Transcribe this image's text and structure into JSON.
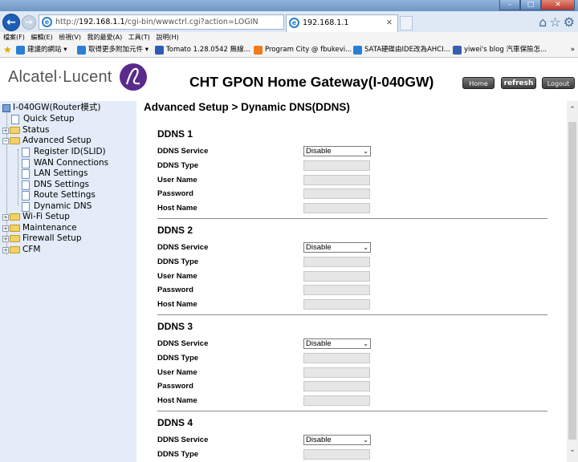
{
  "browser": {
    "address_url_prefix": "http://",
    "address_host": "192.168.1.1",
    "address_path": "/cgi-bin/wwwctrl.cgi?action=LOGIN",
    "tab_title": "192.168.1.1",
    "window_controls": {
      "minimize": "–",
      "maximize": "□",
      "close": "✕"
    }
  },
  "menubar": [
    "檔案(F)",
    "編輯(E)",
    "檢視(V)",
    "我的最愛(A)",
    "工具(T)",
    "說明(H)"
  ],
  "favorites": [
    {
      "label": "建議的網站 ▾",
      "color": "#2a7fd4"
    },
    {
      "label": "取得更多附加元件 ▾",
      "color": "#2a7fd4"
    },
    {
      "label": "Tomato 1.28.0542 無線...",
      "color": "#3358b8"
    },
    {
      "label": "Program City @ fbukevi...",
      "color": "#f07c1c"
    },
    {
      "label": "SATA硬碟由IDE改為AHCI...",
      "color": "#2a7fd4"
    },
    {
      "label": "yiwei's blog 汽車保險怎...",
      "color": "#3560b0"
    }
  ],
  "favorites_more": "»",
  "header": {
    "logo_text": "Alcatel·Lucent",
    "title": "CHT GPON Home Gateway(I-040GW)",
    "home_label": "Home",
    "refresh_label": "refresh",
    "logout_label": "Logout"
  },
  "sidebar": {
    "root": "I-040GW(Router模式)",
    "quick_setup": "Quick Setup",
    "status": "Status",
    "advanced_setup": "Advanced Setup",
    "advanced_children": [
      "Register ID(SLID)",
      "WAN Connections",
      "LAN Settings",
      "DNS Settings",
      "Route Settings",
      "Dynamic DNS"
    ],
    "wifi_setup": "Wi-Fi Setup",
    "maintenance": "Maintenance",
    "firewall_setup": "Firewall Setup",
    "cfm": "CFM"
  },
  "main": {
    "page_title": "Advanced Setup > Dynamic DNS(DDNS)",
    "field_labels": {
      "service": "DDNS Service",
      "type": "DDNS Type",
      "user": "User Name",
      "password": "Password",
      "host": "Host Name"
    },
    "ddns": [
      {
        "title": "DDNS 1",
        "service_value": "Disable"
      },
      {
        "title": "DDNS 2",
        "service_value": "Disable"
      },
      {
        "title": "DDNS 3",
        "service_value": "Disable"
      },
      {
        "title": "DDNS 4",
        "service_value": "Disable"
      }
    ]
  }
}
